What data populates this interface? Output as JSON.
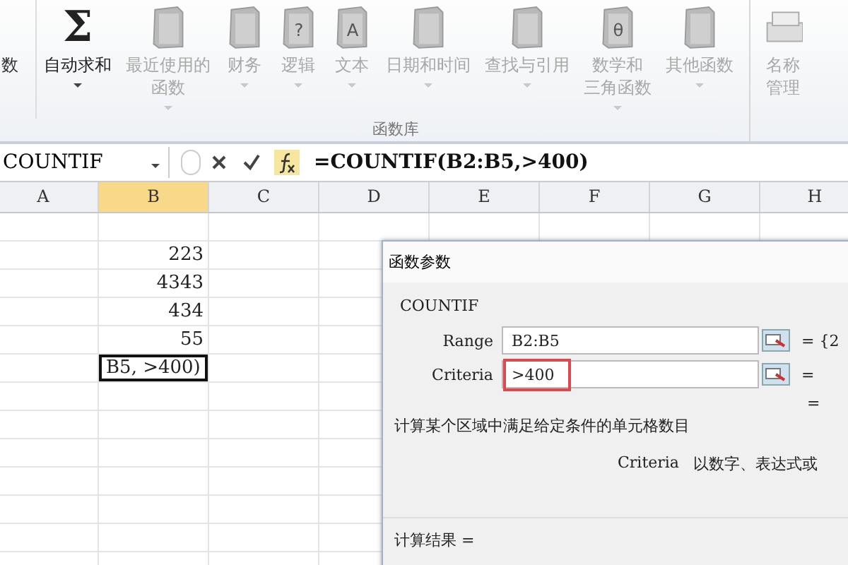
{
  "ribbon": {
    "items": [
      {
        "kind": "cut",
        "lines": [
          "数"
        ],
        "disabled": false,
        "dropdown": false
      },
      {
        "kind": "sum",
        "glyph": "Σ",
        "lines": [
          "自动求和"
        ],
        "disabled": false,
        "dropdown": true
      },
      {
        "kind": "book",
        "lines": [
          "最近使用的",
          "函数"
        ],
        "disabled": true,
        "dropdown": true
      },
      {
        "kind": "book",
        "lines": [
          "财务"
        ],
        "disabled": true,
        "dropdown": true
      },
      {
        "kind": "book",
        "glyph": "?",
        "lines": [
          "逻辑"
        ],
        "disabled": true,
        "dropdown": true
      },
      {
        "kind": "book",
        "glyph": "A",
        "lines": [
          "文本"
        ],
        "disabled": true,
        "dropdown": true
      },
      {
        "kind": "book",
        "lines": [
          "日期和时间"
        ],
        "disabled": true,
        "dropdown": true
      },
      {
        "kind": "book",
        "lines": [
          "查找与引用"
        ],
        "disabled": true,
        "dropdown": true
      },
      {
        "kind": "book",
        "glyph": "θ",
        "lines": [
          "数学和",
          "三角函数"
        ],
        "disabled": true,
        "dropdown": true
      },
      {
        "kind": "book",
        "lines": [
          "其他函数"
        ],
        "disabled": true,
        "dropdown": true
      },
      {
        "kind": "names",
        "lines": [
          "名称",
          "管理"
        ],
        "disabled": true,
        "dropdown": false
      }
    ],
    "group_label": "函数库"
  },
  "formula_bar": {
    "name_box": "COUNTIF",
    "formula": "=COUNTIF(B2:B5,>400)"
  },
  "sheet": {
    "columns": [
      {
        "label": "A",
        "selected": false
      },
      {
        "label": "B",
        "selected": true
      },
      {
        "label": "C",
        "selected": false
      },
      {
        "label": "D",
        "selected": false
      },
      {
        "label": "E",
        "selected": false
      },
      {
        "label": "F",
        "selected": false
      },
      {
        "label": "G",
        "selected": false
      },
      {
        "label": "H",
        "selected": false
      }
    ],
    "column_b_cells": [
      {
        "text": "223",
        "editing": false
      },
      {
        "text": "4343",
        "editing": false
      },
      {
        "text": "434",
        "editing": false
      },
      {
        "text": "55",
        "editing": false
      },
      {
        "text": "B5, >400)",
        "editing": true
      }
    ]
  },
  "dialog": {
    "title": "函数参数",
    "function": "COUNTIF",
    "args": [
      {
        "label": "Range",
        "value": "B2:B5",
        "result": "= {2",
        "highlighted": false
      },
      {
        "label": "Criteria",
        "value": ">400",
        "result": "=",
        "highlighted": true
      }
    ],
    "total": "=",
    "description": "计算某个区域中满足给定条件的单元格数目",
    "arg_help_name": "Criteria",
    "arg_help": "以数字、表达式或",
    "result_label": "计算结果 ="
  }
}
